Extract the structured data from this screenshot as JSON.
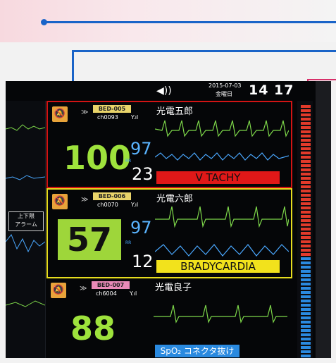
{
  "header": {
    "date": "2015-07-03",
    "weekday": "金曜日",
    "time": "14 17",
    "speaker_icon": "speaker-icon"
  },
  "sidebar": {
    "alarm_button": "上下限\nアラーム"
  },
  "patients": [
    {
      "bed": "BED-005",
      "channel": "ch0093",
      "signal": "Y.ıl",
      "name": "光電五郎",
      "hr": "100",
      "spo2": "97",
      "rr": "23",
      "rr_unit": "RR",
      "alarm": "V TACHY",
      "bed_color": "#e9d46a",
      "hr_color": "#9ee23c",
      "alarm_color": "#e01818"
    },
    {
      "bed": "BED-006",
      "channel": "ch0070",
      "signal": "Y.ıl",
      "name": "光電六郎",
      "hr": "57",
      "spo2": "97",
      "rr": "12",
      "rr_unit": "RR",
      "alarm": "BRADYCARDIA",
      "bed_color": "#e9d46a",
      "hr_color": "#111111",
      "hr_bg": "#9ed63a",
      "alarm_color": "#f2e21c"
    },
    {
      "bed": "BED-007",
      "channel": "ch6004",
      "signal": "Y.ıl",
      "name": "光電良子",
      "hr": "88",
      "spo2": "",
      "rr": "",
      "alarm": "SpO₂ コネクタ抜け",
      "bed_color": "#e98ab8",
      "hr_color": "#9ee23c",
      "alarm_color": "#2a8ae0"
    }
  ]
}
